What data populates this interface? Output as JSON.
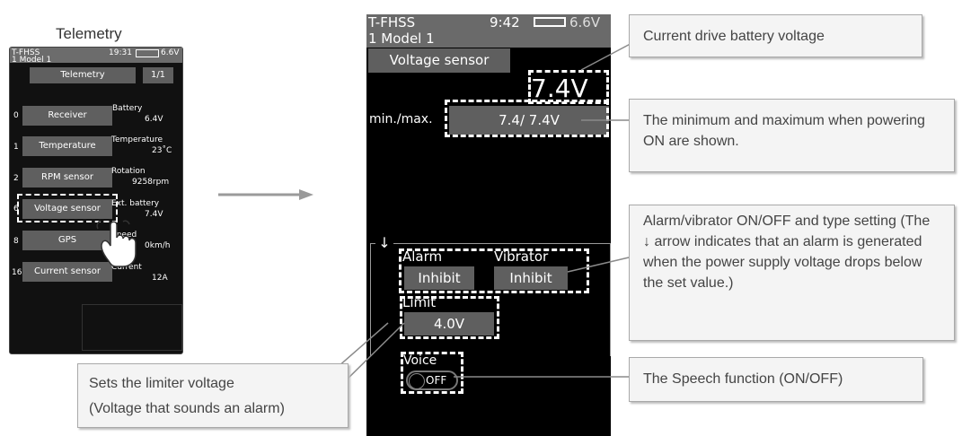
{
  "caption": "Telemetry",
  "small_screen": {
    "system": "T-FHSS",
    "time": "19:31",
    "voltage": "6.6V",
    "model": "1   Model 1",
    "title": "Telemetry",
    "page": "1/1",
    "rows": [
      {
        "num": "0",
        "button": "Receiver",
        "label": "Battery",
        "value": "6.4V"
      },
      {
        "num": "1",
        "button": "Temperature",
        "label": "Temperature",
        "value": "23˚C"
      },
      {
        "num": "2",
        "button": "RPM sensor",
        "label": "Rotation",
        "value": "9258rpm"
      },
      {
        "num": "6",
        "button": "Voltage sensor",
        "label": "Ext. battery",
        "value": "7.4V"
      },
      {
        "num": "8",
        "button": "GPS",
        "label": "Speed",
        "value": "0km/h"
      },
      {
        "num": "16",
        "button": "Current sensor",
        "label": "Current",
        "value": "12A"
      }
    ]
  },
  "big_screen": {
    "system": "T-FHSS",
    "time": "9:42",
    "voltage": "6.6V",
    "model": "1   Model 1",
    "title": "Voltage sensor",
    "current_voltage": "7.4V",
    "minmax_label": "min./max.",
    "minmax_value": "7.4/  7.4V",
    "drop_arrow": "↓",
    "alarm_label": "Alarm",
    "alarm_value": "Inhibit",
    "vibrator_label": "Vibrator",
    "vibrator_value": "Inhibit",
    "limit_label": "Limit",
    "limit_value": "4.0V",
    "voice_label": "Voice",
    "voice_toggle": "OFF"
  },
  "callouts": {
    "drive_battery": "Current drive battery voltage",
    "minmax": "The minimum and maximum when powering ON are shown.",
    "alarm": "Alarm/vibrator ON/OFF and type setting (The ↓ arrow indicates that an alarm is generated when the power supply voltage drops below the set value.)",
    "speech": "The Speech function (ON/OFF)",
    "limiter_line1": "Sets the limiter voltage",
    "limiter_line2": "(Voltage that sounds an alarm)"
  },
  "colors": {
    "screen_bg": "#000000",
    "button": "#5f5f5f",
    "callout_bg": "#f4f4f4",
    "callout_text": "#444444"
  }
}
